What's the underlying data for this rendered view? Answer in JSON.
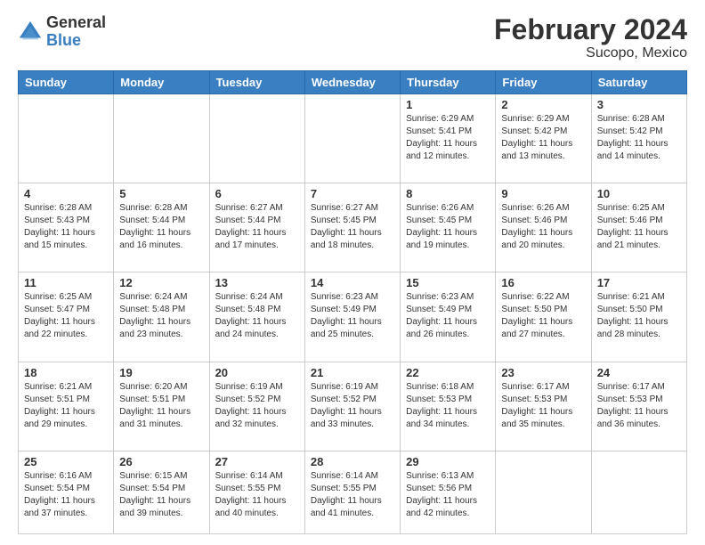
{
  "header": {
    "logo_general": "General",
    "logo_blue": "Blue",
    "title": "February 2024",
    "subtitle": "Sucopo, Mexico"
  },
  "days_of_week": [
    "Sunday",
    "Monday",
    "Tuesday",
    "Wednesday",
    "Thursday",
    "Friday",
    "Saturday"
  ],
  "weeks": [
    [
      {
        "day": "",
        "info": ""
      },
      {
        "day": "",
        "info": ""
      },
      {
        "day": "",
        "info": ""
      },
      {
        "day": "",
        "info": ""
      },
      {
        "day": "1",
        "info": "Sunrise: 6:29 AM\nSunset: 5:41 PM\nDaylight: 11 hours and 12 minutes."
      },
      {
        "day": "2",
        "info": "Sunrise: 6:29 AM\nSunset: 5:42 PM\nDaylight: 11 hours and 13 minutes."
      },
      {
        "day": "3",
        "info": "Sunrise: 6:28 AM\nSunset: 5:42 PM\nDaylight: 11 hours and 14 minutes."
      }
    ],
    [
      {
        "day": "4",
        "info": "Sunrise: 6:28 AM\nSunset: 5:43 PM\nDaylight: 11 hours and 15 minutes."
      },
      {
        "day": "5",
        "info": "Sunrise: 6:28 AM\nSunset: 5:44 PM\nDaylight: 11 hours and 16 minutes."
      },
      {
        "day": "6",
        "info": "Sunrise: 6:27 AM\nSunset: 5:44 PM\nDaylight: 11 hours and 17 minutes."
      },
      {
        "day": "7",
        "info": "Sunrise: 6:27 AM\nSunset: 5:45 PM\nDaylight: 11 hours and 18 minutes."
      },
      {
        "day": "8",
        "info": "Sunrise: 6:26 AM\nSunset: 5:45 PM\nDaylight: 11 hours and 19 minutes."
      },
      {
        "day": "9",
        "info": "Sunrise: 6:26 AM\nSunset: 5:46 PM\nDaylight: 11 hours and 20 minutes."
      },
      {
        "day": "10",
        "info": "Sunrise: 6:25 AM\nSunset: 5:46 PM\nDaylight: 11 hours and 21 minutes."
      }
    ],
    [
      {
        "day": "11",
        "info": "Sunrise: 6:25 AM\nSunset: 5:47 PM\nDaylight: 11 hours and 22 minutes."
      },
      {
        "day": "12",
        "info": "Sunrise: 6:24 AM\nSunset: 5:48 PM\nDaylight: 11 hours and 23 minutes."
      },
      {
        "day": "13",
        "info": "Sunrise: 6:24 AM\nSunset: 5:48 PM\nDaylight: 11 hours and 24 minutes."
      },
      {
        "day": "14",
        "info": "Sunrise: 6:23 AM\nSunset: 5:49 PM\nDaylight: 11 hours and 25 minutes."
      },
      {
        "day": "15",
        "info": "Sunrise: 6:23 AM\nSunset: 5:49 PM\nDaylight: 11 hours and 26 minutes."
      },
      {
        "day": "16",
        "info": "Sunrise: 6:22 AM\nSunset: 5:50 PM\nDaylight: 11 hours and 27 minutes."
      },
      {
        "day": "17",
        "info": "Sunrise: 6:21 AM\nSunset: 5:50 PM\nDaylight: 11 hours and 28 minutes."
      }
    ],
    [
      {
        "day": "18",
        "info": "Sunrise: 6:21 AM\nSunset: 5:51 PM\nDaylight: 11 hours and 29 minutes."
      },
      {
        "day": "19",
        "info": "Sunrise: 6:20 AM\nSunset: 5:51 PM\nDaylight: 11 hours and 31 minutes."
      },
      {
        "day": "20",
        "info": "Sunrise: 6:19 AM\nSunset: 5:52 PM\nDaylight: 11 hours and 32 minutes."
      },
      {
        "day": "21",
        "info": "Sunrise: 6:19 AM\nSunset: 5:52 PM\nDaylight: 11 hours and 33 minutes."
      },
      {
        "day": "22",
        "info": "Sunrise: 6:18 AM\nSunset: 5:53 PM\nDaylight: 11 hours and 34 minutes."
      },
      {
        "day": "23",
        "info": "Sunrise: 6:17 AM\nSunset: 5:53 PM\nDaylight: 11 hours and 35 minutes."
      },
      {
        "day": "24",
        "info": "Sunrise: 6:17 AM\nSunset: 5:53 PM\nDaylight: 11 hours and 36 minutes."
      }
    ],
    [
      {
        "day": "25",
        "info": "Sunrise: 6:16 AM\nSunset: 5:54 PM\nDaylight: 11 hours and 37 minutes."
      },
      {
        "day": "26",
        "info": "Sunrise: 6:15 AM\nSunset: 5:54 PM\nDaylight: 11 hours and 39 minutes."
      },
      {
        "day": "27",
        "info": "Sunrise: 6:14 AM\nSunset: 5:55 PM\nDaylight: 11 hours and 40 minutes."
      },
      {
        "day": "28",
        "info": "Sunrise: 6:14 AM\nSunset: 5:55 PM\nDaylight: 11 hours and 41 minutes."
      },
      {
        "day": "29",
        "info": "Sunrise: 6:13 AM\nSunset: 5:56 PM\nDaylight: 11 hours and 42 minutes."
      },
      {
        "day": "",
        "info": ""
      },
      {
        "day": "",
        "info": ""
      }
    ]
  ]
}
